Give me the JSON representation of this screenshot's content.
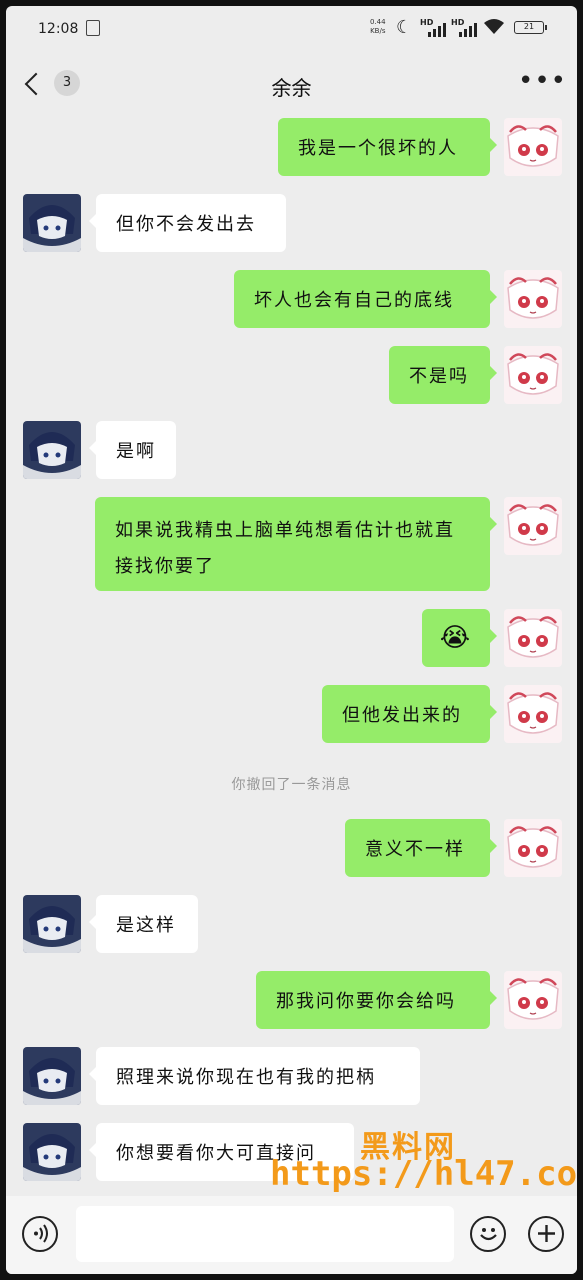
{
  "status": {
    "time": "12:08",
    "net_speed_top": "0.44",
    "net_speed_unit": "KB/s",
    "sim1": "HD",
    "sim2": "HD",
    "battery": "21"
  },
  "header": {
    "unread_count": "3",
    "title": "余余"
  },
  "messages": [
    {
      "side": "mine",
      "text": "我是一个很坏的人"
    },
    {
      "side": "theirs",
      "text": "但你不会发出去"
    },
    {
      "side": "mine",
      "text": "坏人也会有自己的底线"
    },
    {
      "side": "mine",
      "text": "不是吗"
    },
    {
      "side": "theirs",
      "text": "是啊"
    },
    {
      "side": "mine",
      "text": "如果说我精虫上脑单纯想看估计也就直接找你要了"
    },
    {
      "side": "mine",
      "text": "😭"
    },
    {
      "side": "mine",
      "text": "但他发出来的"
    },
    {
      "side": "mine",
      "text": "意义不一样"
    },
    {
      "side": "theirs",
      "text": "是这样"
    },
    {
      "side": "mine",
      "text": "那我问你要你会给吗"
    },
    {
      "side": "theirs",
      "text": "照理来说你现在也有我的把柄"
    },
    {
      "side": "theirs",
      "text": "你想要看你大可直接问"
    }
  ],
  "system_note": "你撤回了一条消息",
  "inputbar": {
    "voice_icon": "voice-icon",
    "emoji_icon": "emoji-icon",
    "plus_icon": "plus-icon"
  },
  "watermark": {
    "top": "黑料网",
    "bottom": "https://hl47.co"
  },
  "colors": {
    "mine_bubble": "#95ec69",
    "theirs_bubble": "#ffffff",
    "background": "#ededed",
    "watermark": "#f39a1a"
  }
}
